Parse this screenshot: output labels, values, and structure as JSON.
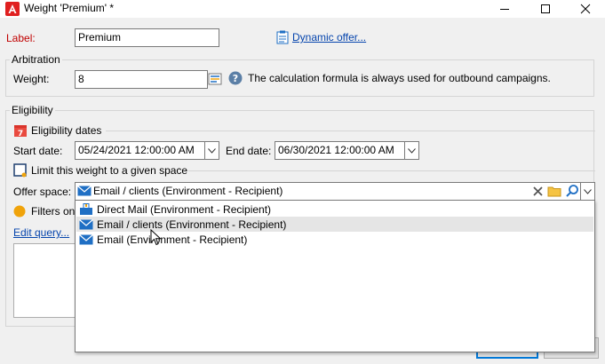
{
  "window": {
    "title": "Weight 'Premium' *",
    "controls": {
      "minimize": "—",
      "maximize": "☐",
      "close": "✕"
    }
  },
  "form": {
    "label_caption": "Label:",
    "label_value": "Premium",
    "dynamic_offer_link": "Dynamic offer..."
  },
  "arbitration": {
    "group_title": "Arbitration",
    "weight_caption": "Weight:",
    "weight_value": "8",
    "help_text": "The calculation formula is always used for outbound campaigns."
  },
  "eligibility": {
    "group_title": "Eligibility",
    "dates_section": "Eligibility dates",
    "start_caption": "Start date:",
    "start_value": "05/24/2021 12:00:00 AM",
    "end_caption": "End date:",
    "end_value": "06/30/2021 12:00:00 AM",
    "limit_checkbox_label": "Limit this weight to a given space",
    "limit_checked": false,
    "offer_space_caption": "Offer space:",
    "offer_space_value": "Email / clients (Environment - Recipient)",
    "filters_label": "Filters on",
    "edit_query_link": "Edit query..."
  },
  "dropdown": {
    "items": [
      {
        "label": "Direct Mail (Environment - Recipient)",
        "icon": "direct-mail-icon",
        "selected": false
      },
      {
        "label": "Email / clients (Environment - Recipient)",
        "icon": "email-icon",
        "selected": true
      },
      {
        "label": "Email (Environment - Recipient)",
        "icon": "email-icon",
        "selected": false
      }
    ]
  },
  "colors": {
    "label_red": "#c00000",
    "link_blue": "#0645ad",
    "help_icon": "#5b7fa6",
    "email_icon": "#1f6fc4",
    "filter_dot": "#f0a30a",
    "folder_icon": "#f5c342",
    "calendar_red": "#d9342b"
  }
}
